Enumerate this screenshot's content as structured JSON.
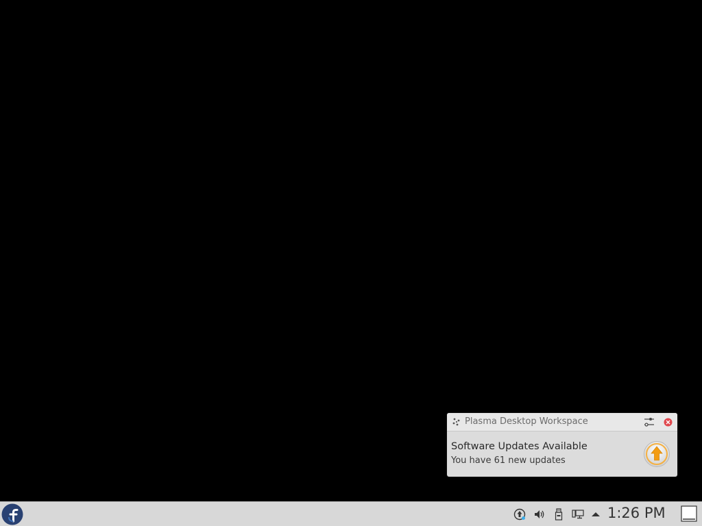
{
  "notification": {
    "app_name": "Plasma Desktop Workspace",
    "title": "Software Updates Available",
    "body": "You have 61 new updates",
    "app_icon": "plasma-icon",
    "config_icon": "configure-icon",
    "close_icon": "close-icon",
    "main_icon": "software-update-icon"
  },
  "taskbar": {
    "launcher_icon": "fedora-logo-icon",
    "tray": [
      {
        "name": "update-notifier-icon"
      },
      {
        "name": "volume-icon"
      },
      {
        "name": "usb-device-icon"
      },
      {
        "name": "network-icon"
      },
      {
        "name": "tray-expand-icon"
      }
    ],
    "clock": "1:26 PM",
    "show_desktop_icon": "show-desktop-icon"
  },
  "colors": {
    "desktop_bg": "#000000",
    "taskbar_bg": "#d8d8d8",
    "notification_bg": "#dcdcdc",
    "close_red": "#e0484e",
    "update_orange": "#f39c12",
    "fedora_blue": "#294172"
  }
}
